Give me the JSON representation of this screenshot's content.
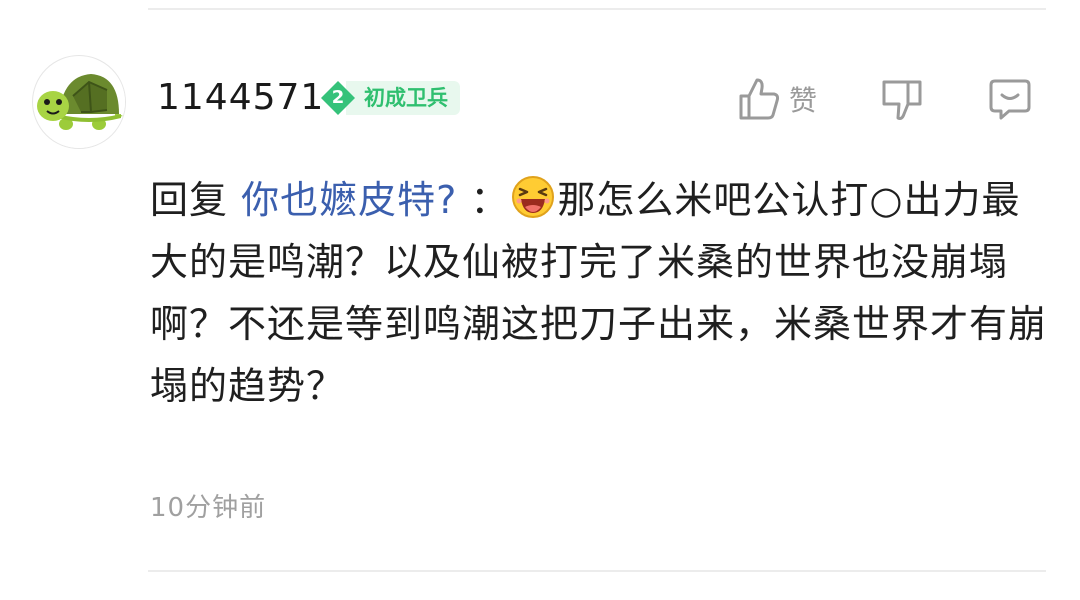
{
  "comment": {
    "author": {
      "name": "1144571",
      "level": "2",
      "title": "初成卫兵",
      "avatar": "turtle-avatar"
    },
    "actions": {
      "like_label": "赞",
      "like_icon": "thumbs-up-icon",
      "dislike_icon": "thumbs-down-icon",
      "reply_icon": "comment-bubble-icon"
    },
    "reply_prefix": "回复",
    "reply_to": "你也嬷皮特?",
    "reply_separator": "  ：",
    "emoji": "laughing-emoji",
    "body": "那怎么米吧公认打○出力最大的是鸣潮？以及仙被打完了米桑的世界也没崩塌啊？不还是等到鸣潮这把刀子出来，米桑世界才有崩塌的趋势？",
    "time": "10分钟前"
  },
  "colors": {
    "link": "#3b5fae",
    "badge_green": "#2fbf6f",
    "badge_bg": "#e8f8ee",
    "muted": "#9a9a9a"
  }
}
